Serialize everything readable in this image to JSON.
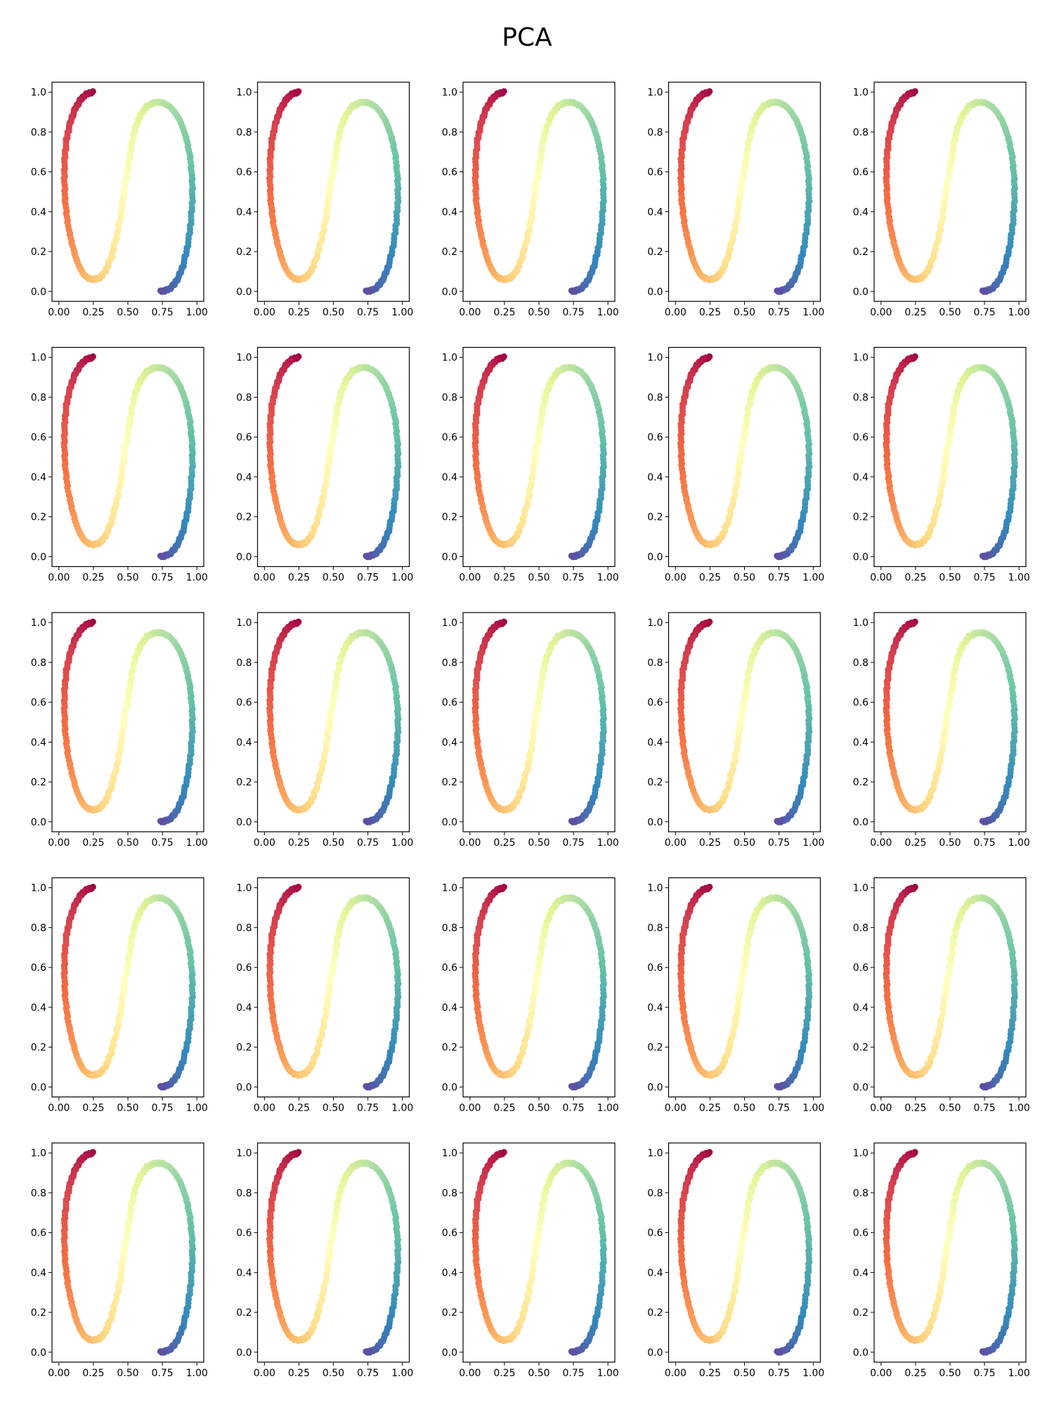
{
  "title": "PCA",
  "grid": {
    "rows": 5,
    "cols": 5
  },
  "colors": {
    "colormap": "Spectral",
    "stops": [
      "#9e0142",
      "#d53e4f",
      "#f46d43",
      "#fdae61",
      "#fee08b",
      "#ffffbf",
      "#e6f598",
      "#abdda4",
      "#66c2a5",
      "#3288bd",
      "#5e4fa2"
    ]
  },
  "chart_data": {
    "type": "scatter",
    "description_of_series": "S-curve points colored along the curve parameter; identical in all 25 panels",
    "xlim": [
      -0.05,
      1.05
    ],
    "ylim": [
      -0.05,
      1.05
    ],
    "xticks": [
      "0.00",
      "0.25",
      "0.50",
      "0.75",
      "1.00"
    ],
    "yticks": [
      "0.0",
      "0.2",
      "0.4",
      "0.6",
      "0.8",
      "1.0"
    ],
    "xtick_values": [
      0.0,
      0.25,
      0.5,
      0.75,
      1.0
    ],
    "ytick_values": [
      0.0,
      0.2,
      0.4,
      0.6,
      0.8,
      1.0
    ],
    "grid": false,
    "points": [
      [
        0.25,
        1.0
      ],
      [
        0.215,
        0.995
      ],
      [
        0.18,
        0.98
      ],
      [
        0.15,
        0.955
      ],
      [
        0.12,
        0.92
      ],
      [
        0.095,
        0.875
      ],
      [
        0.072,
        0.82
      ],
      [
        0.055,
        0.76
      ],
      [
        0.044,
        0.69
      ],
      [
        0.04,
        0.62
      ],
      [
        0.04,
        0.55
      ],
      [
        0.044,
        0.47
      ],
      [
        0.055,
        0.39
      ],
      [
        0.072,
        0.31
      ],
      [
        0.095,
        0.24
      ],
      [
        0.12,
        0.175
      ],
      [
        0.15,
        0.12
      ],
      [
        0.18,
        0.085
      ],
      [
        0.215,
        0.065
      ],
      [
        0.25,
        0.06
      ],
      [
        0.285,
        0.065
      ],
      [
        0.32,
        0.085
      ],
      [
        0.35,
        0.12
      ],
      [
        0.38,
        0.175
      ],
      [
        0.405,
        0.24
      ],
      [
        0.43,
        0.31
      ],
      [
        0.45,
        0.39
      ],
      [
        0.465,
        0.47
      ],
      [
        0.48,
        0.54
      ],
      [
        0.5,
        0.61
      ],
      [
        0.515,
        0.68
      ],
      [
        0.53,
        0.75
      ],
      [
        0.55,
        0.81
      ],
      [
        0.575,
        0.86
      ],
      [
        0.605,
        0.9
      ],
      [
        0.64,
        0.93
      ],
      [
        0.68,
        0.945
      ],
      [
        0.72,
        0.95
      ],
      [
        0.76,
        0.945
      ],
      [
        0.8,
        0.93
      ],
      [
        0.84,
        0.9
      ],
      [
        0.875,
        0.86
      ],
      [
        0.905,
        0.81
      ],
      [
        0.93,
        0.75
      ],
      [
        0.95,
        0.68
      ],
      [
        0.962,
        0.6
      ],
      [
        0.968,
        0.52
      ],
      [
        0.966,
        0.44
      ],
      [
        0.958,
        0.36
      ],
      [
        0.945,
        0.28
      ],
      [
        0.925,
        0.2
      ],
      [
        0.9,
        0.13
      ],
      [
        0.87,
        0.075
      ],
      [
        0.835,
        0.035
      ],
      [
        0.8,
        0.012
      ],
      [
        0.765,
        0.003
      ],
      [
        0.74,
        0.0
      ]
    ]
  }
}
